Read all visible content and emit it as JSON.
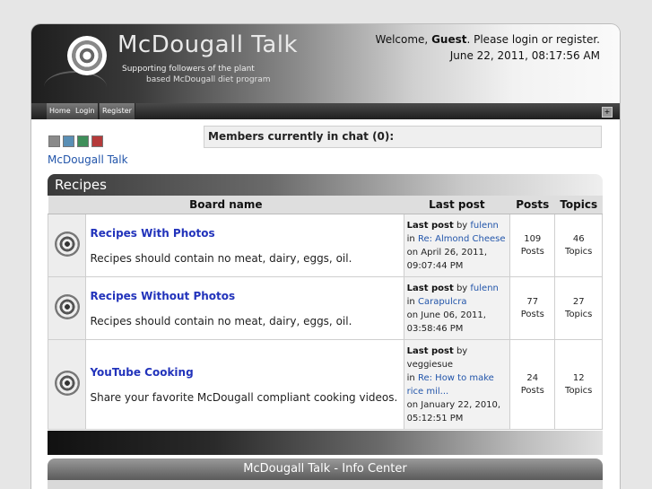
{
  "header": {
    "site_title": "McDougall Talk",
    "tagline_line1": "Supporting followers of the plant",
    "tagline_line2": "based McDougall diet program",
    "welcome_prefix": "Welcome, ",
    "welcome_user": "Guest",
    "welcome_suffix": ". Please login or register.",
    "datetime": "June 22, 2011, 08:17:56 AM"
  },
  "nav": {
    "items": [
      {
        "label": "Home"
      },
      {
        "label": "Login"
      },
      {
        "label": "Register"
      }
    ],
    "collapse_label": "+"
  },
  "theme_swatches": [
    "#8a8a8a",
    "#5a8fb5",
    "#3f8f5a",
    "#b53a3a"
  ],
  "breadcrumb": {
    "home": "McDougall Talk"
  },
  "chat": {
    "label": "Members currently in chat (0):"
  },
  "category": {
    "title": "Recipes",
    "columns": {
      "board_name": "Board name",
      "last_post": "Last post",
      "posts": "Posts",
      "topics": "Topics"
    },
    "boards": [
      {
        "name": "Recipes With Photos",
        "description": "Recipes should contain no meat, dairy, eggs, oil.",
        "last_post": {
          "label": "Last post",
          "by": "by",
          "author": "fulenn",
          "in": "in",
          "topic": "Re: Almond Cheese",
          "on": "on April 26, 2011,",
          "time": "09:07:44 PM"
        },
        "posts": {
          "count": "109",
          "label": "Posts"
        },
        "topics": {
          "count": "46",
          "label": "Topics"
        }
      },
      {
        "name": "Recipes Without Photos",
        "description": "Recipes should contain no meat, dairy, eggs, oil.",
        "last_post": {
          "label": "Last post",
          "by": "by",
          "author": "fulenn",
          "in": "in",
          "topic": "Carapulcra",
          "on": "on June 06, 2011,",
          "time": "03:58:46 PM"
        },
        "posts": {
          "count": "77",
          "label": "Posts"
        },
        "topics": {
          "count": "27",
          "label": "Topics"
        }
      },
      {
        "name": "YouTube Cooking",
        "description": "Share your favorite McDougall compliant cooking videos.",
        "last_post": {
          "label": "Last post",
          "by": "by",
          "author": "veggiesue",
          "in": "in",
          "topic_line1": "Re: How to make",
          "topic_line2": "rice mil...",
          "on": "on January 22, 2010,",
          "time": "05:12:51 PM"
        },
        "posts": {
          "count": "24",
          "label": "Posts"
        },
        "topics": {
          "count": "12",
          "label": "Topics"
        }
      }
    ]
  },
  "info_center": {
    "title": "McDougall Talk - Info Center"
  }
}
